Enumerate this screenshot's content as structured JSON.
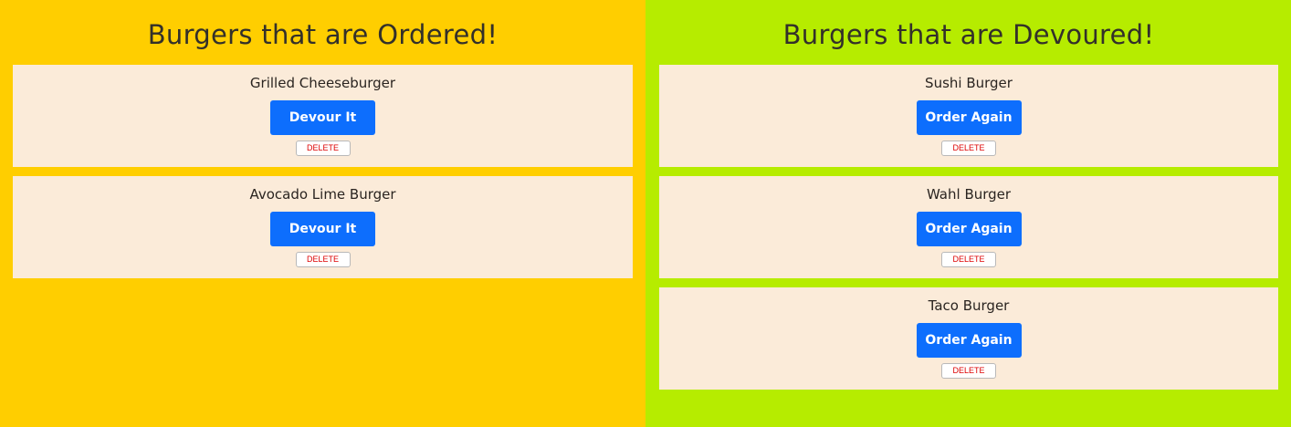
{
  "theme": {
    "ordered_bg": "#ffce00",
    "devoured_bg": "#b6ec00",
    "card_bg": "#fbebd9",
    "button_bg": "#0d6efd",
    "delete_text": "#dd0000"
  },
  "ordered": {
    "title": "Burgers that are Ordered!",
    "items": [
      {
        "name": "Grilled Cheeseburger",
        "action": "Devour It",
        "delete": "DELETE"
      },
      {
        "name": "Avocado Lime Burger",
        "action": "Devour It",
        "delete": "DELETE"
      }
    ]
  },
  "devoured": {
    "title": "Burgers that are Devoured!",
    "items": [
      {
        "name": "Sushi Burger",
        "action": "Order Again",
        "delete": "DELETE"
      },
      {
        "name": "Wahl Burger",
        "action": "Order Again",
        "delete": "DELETE"
      },
      {
        "name": "Taco Burger",
        "action": "Order Again",
        "delete": "DELETE"
      }
    ]
  }
}
